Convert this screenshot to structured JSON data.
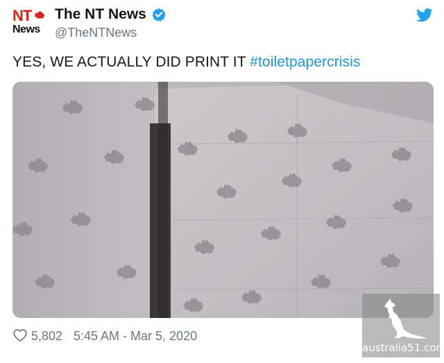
{
  "account": {
    "logo_line1": "NT",
    "logo_line2": "News",
    "display_name": "The NT News",
    "handle": "@TheNTNews",
    "verified": true
  },
  "tweet": {
    "text_plain": "YES, WE ACTUALLY DID PRINT IT ",
    "hashtag": "#toiletpapercrisis",
    "media_icon": "photo-of-printed-newspaper-pages",
    "likes": "5,802",
    "timestamp": "5:45 AM - Mar 5, 2020"
  },
  "watermark": {
    "text": "australia51.com"
  },
  "icons": {
    "verified": "verified-badge-icon",
    "bird": "twitter-bird-icon",
    "like": "heart-icon"
  },
  "colors": {
    "accent": "#1b95e0",
    "text": "#14171a",
    "muted": "#657786",
    "logo_red": "#e0201b"
  }
}
